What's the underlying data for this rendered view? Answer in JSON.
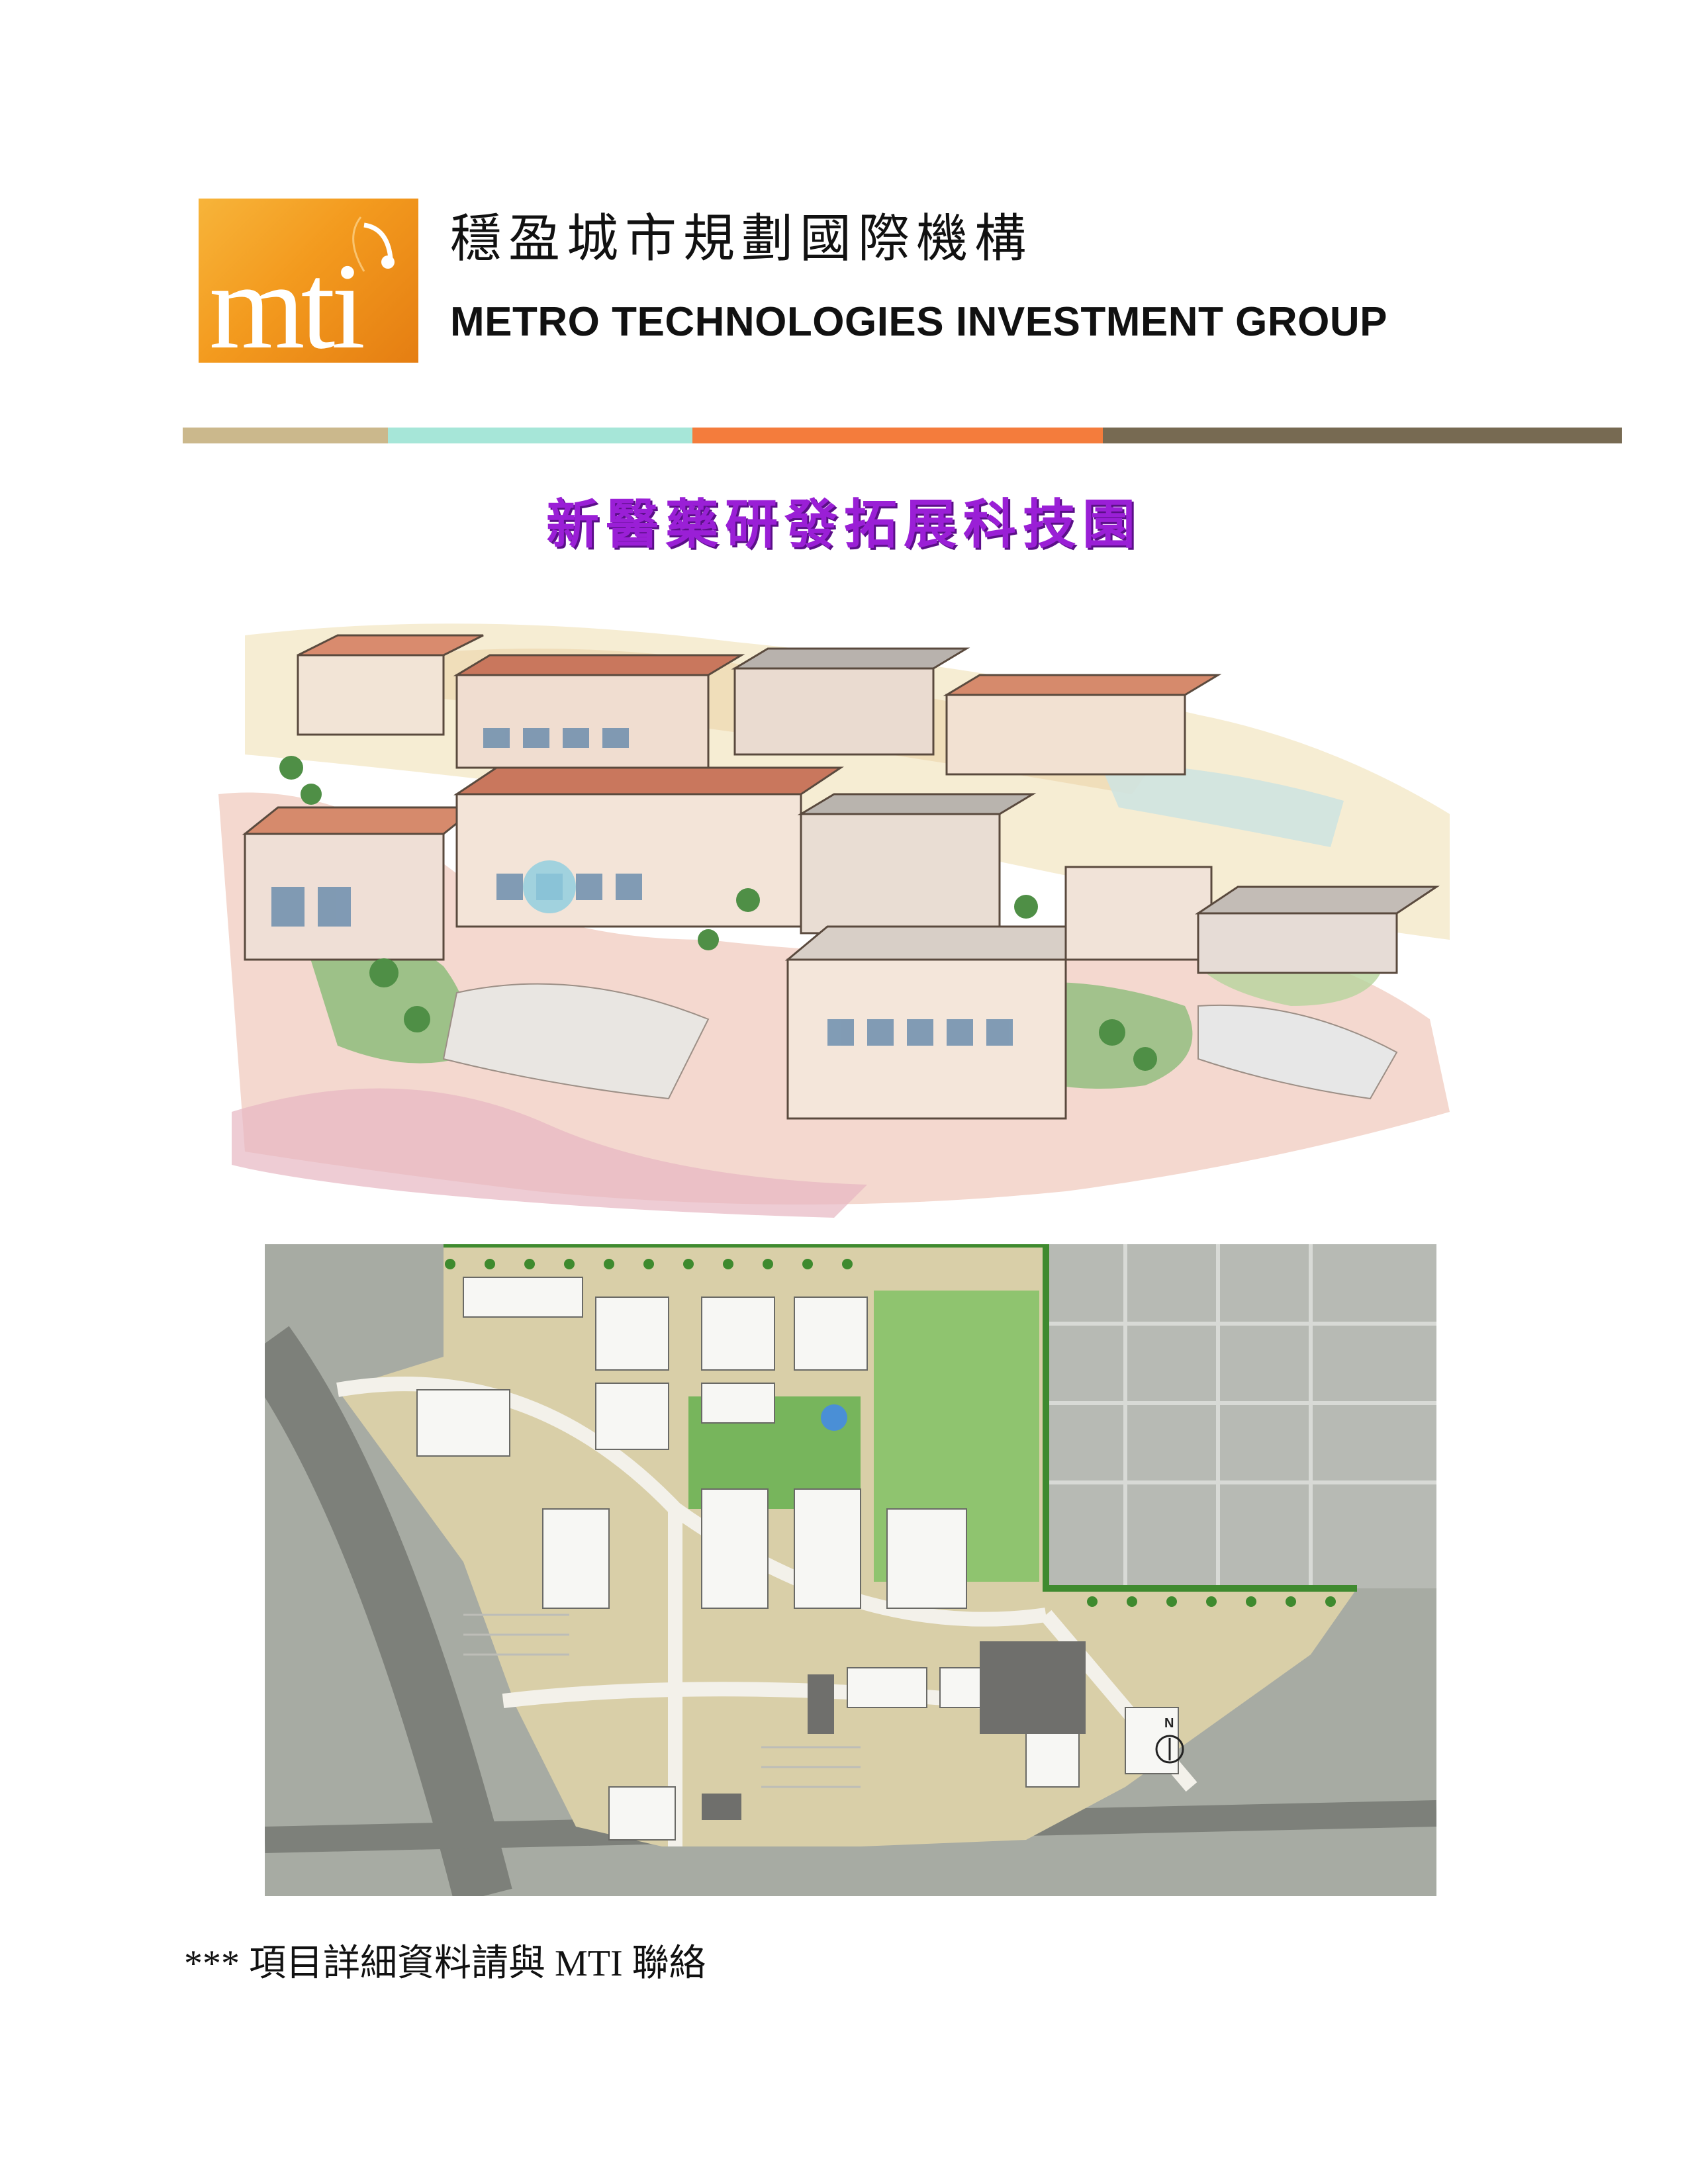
{
  "header": {
    "logo_text": "mti",
    "org_name_cn": "穩盈城市規劃國際機構",
    "org_name_en": "METRO TECHNOLOGIES INVESTMENT GROUP",
    "logo_color": "#f39a1e"
  },
  "divider": {
    "colors": [
      "#cbb88c",
      "#a6e6d8",
      "#f47c3c",
      "#776a52"
    ]
  },
  "project": {
    "title": "新醫藥研發拓展科技園",
    "title_color": "#9a1fd6"
  },
  "images": {
    "rendering": "aerial-rendering",
    "siteplan": "site-plan",
    "north_label": "N"
  },
  "footer": {
    "note": "*** 項目詳細資料請與 MTI 聯絡"
  }
}
